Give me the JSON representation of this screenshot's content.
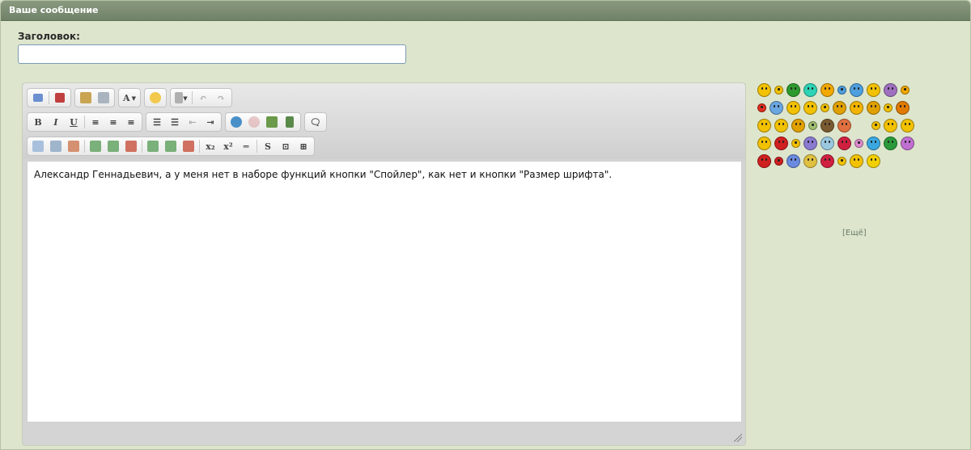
{
  "panel": {
    "title": "Ваше сообщение"
  },
  "form": {
    "title_label": "Заголовок:",
    "title_value": ""
  },
  "editor": {
    "text": "Александр Геннадьевич, а у меня нет в наборе функций кнопки \"Спойлер\", как нет и кнопки \"Размер шрифта\".",
    "toolbar": {
      "bold": "B",
      "italic": "I",
      "underline": "U",
      "font_color": "A",
      "strike": "S",
      "subscript": "x₂",
      "superscript": "x²"
    }
  },
  "smileys": {
    "more_label": "[Ещё]",
    "rows": [
      [
        "#f2c100",
        "#f2c100",
        "#2f9a2f",
        "#2dd3b5",
        "#f2a800",
        "#4e9fde",
        "#4e9fde",
        "#f2c100",
        "#a070c0",
        "#f2a800"
      ],
      [
        "#e03020",
        "#6aa6e0",
        "#f2c100",
        "#f2c100",
        "#f2c100",
        "#e0a000",
        "#f2b400",
        "#e0a000",
        "#f2c100",
        "#e07a00"
      ],
      [
        "#f2c100",
        "#f2c100",
        "#e0a000",
        "#a0c070",
        "#7a5a30",
        "#e07040",
        "blank",
        "#f2c100",
        "#f2c100",
        "#f2c100"
      ],
      [
        "#f2c100",
        "#d02020",
        "#f2c100",
        "#8a7ad0",
        "#9ac8e0",
        "#d02040",
        "#e08ad0",
        "#3aa8e0",
        "#2a9a3a",
        "#c070d0"
      ],
      [
        "#d02020",
        "#d02020",
        "#6a8ae0",
        "#e0c040",
        "#d02040",
        "#f2c100",
        "#f2c100",
        "#f2d000"
      ]
    ]
  },
  "colors": {
    "header_bg": "#7a8b70",
    "panel_bg": "#dde5cd",
    "input_border": "#7a9ab3"
  }
}
